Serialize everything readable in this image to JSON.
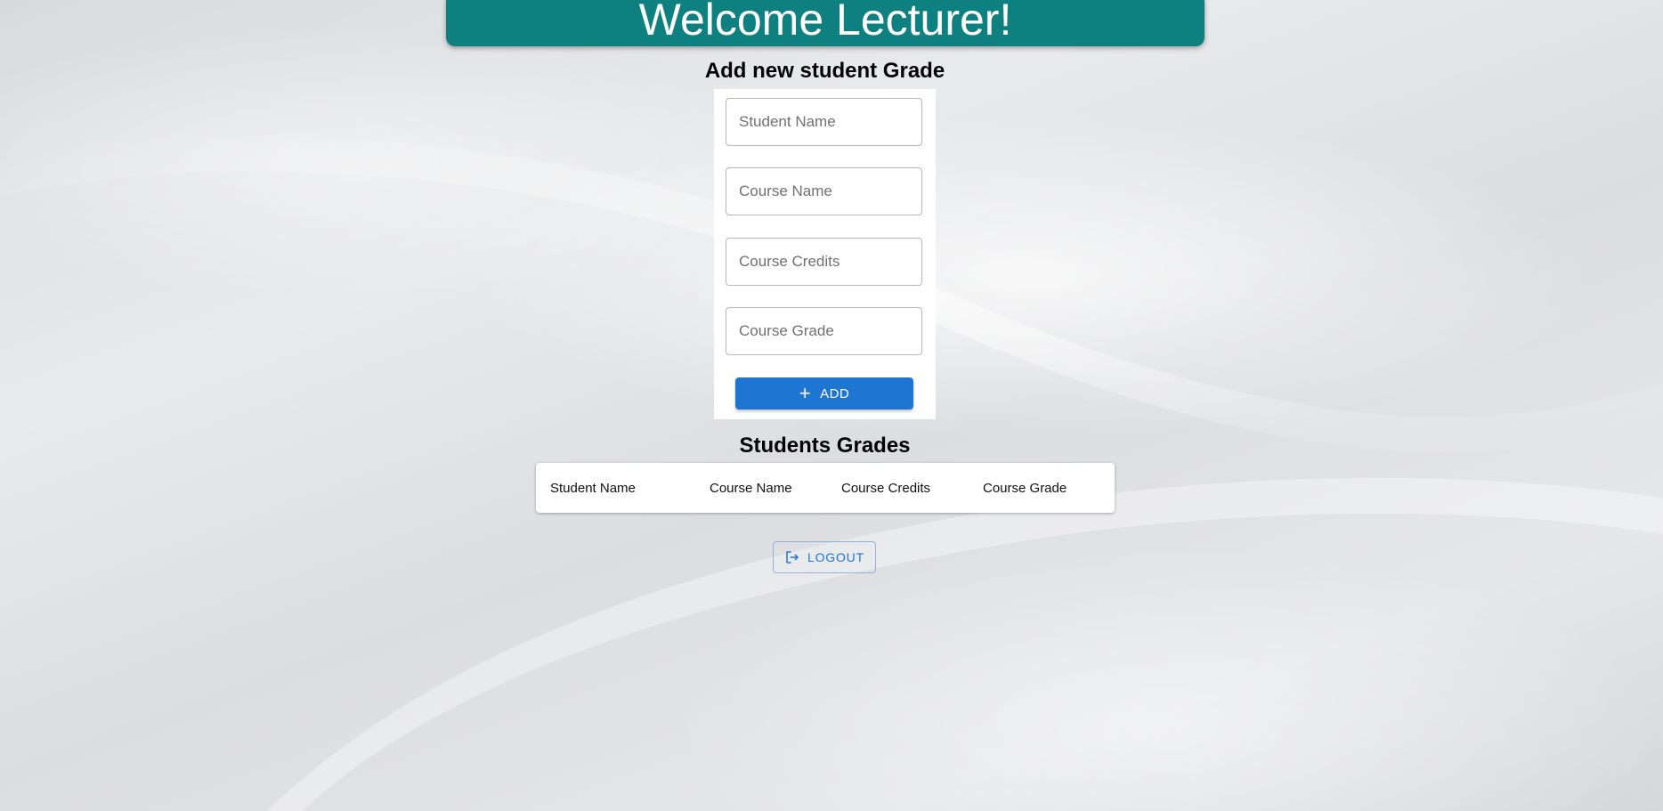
{
  "header": {
    "title": "Welcome Lecturer!",
    "color": "#0e8080"
  },
  "add_form": {
    "title": "Add new student Grade",
    "fields": {
      "student_name": {
        "placeholder": "Student Name",
        "value": ""
      },
      "course_name": {
        "placeholder": "Course Name",
        "value": ""
      },
      "course_credits": {
        "placeholder": "Course Credits",
        "value": ""
      },
      "course_grade": {
        "placeholder": "Course Grade",
        "value": ""
      }
    },
    "add_button": {
      "label": "ADD",
      "icon": "plus-icon",
      "color": "#1e76d2"
    }
  },
  "grades_table": {
    "title": "Students Grades",
    "columns": [
      "Student Name",
      "Course Name",
      "Course Credits",
      "Course Grade"
    ],
    "rows": []
  },
  "logout_button": {
    "label": "LOGOUT",
    "icon": "logout-icon"
  }
}
